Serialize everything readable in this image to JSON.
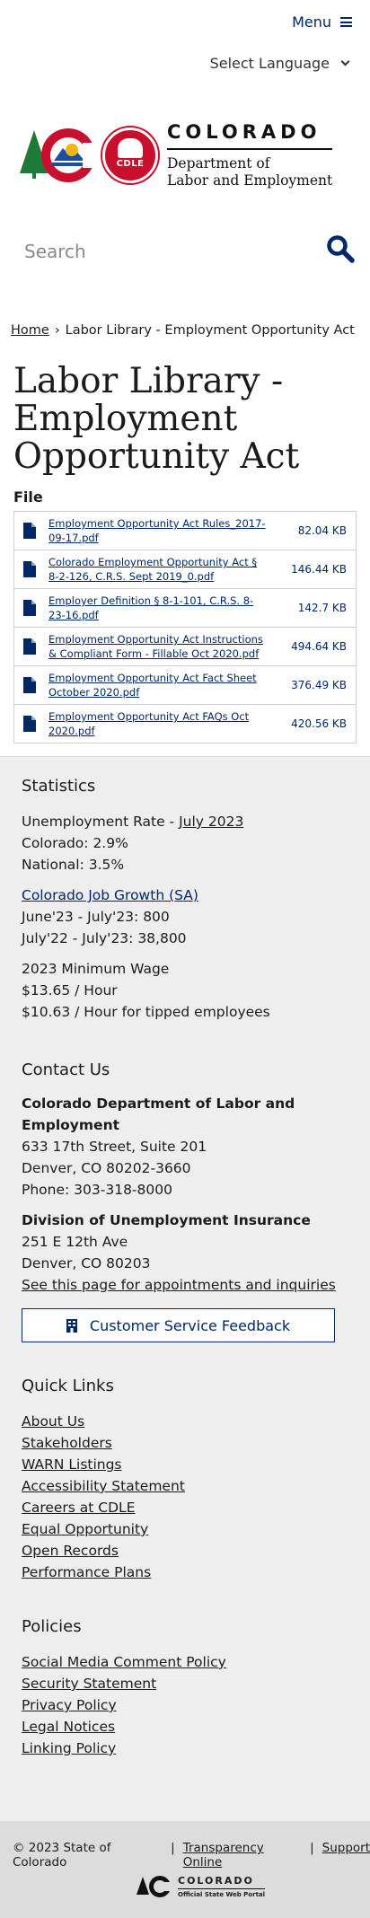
{
  "header": {
    "menu_label": "Menu",
    "language_label": "Select Language",
    "brand": "COLORADO",
    "dept_line1": "Department of",
    "dept_line2": "Labor and Employment",
    "seal_label": "CDLE",
    "search_placeholder": "Search"
  },
  "breadcrumb": {
    "home": "Home",
    "separator": "›",
    "current": "Labor Library - Employment Opportunity Act"
  },
  "page": {
    "title": "Labor Library - Employment Opportunity Act",
    "file_label": "File",
    "files": [
      {
        "name": "Employment Opportunity Act Rules_2017-09-17.pdf",
        "size": "82.04 KB"
      },
      {
        "name": "Colorado Employment Opportunity Act § 8-2-126, C.R.S. Sept 2019_0.pdf",
        "size": "146.44 KB"
      },
      {
        "name": "Employer Definition § 8-1-101, C.R.S. 8-23-16.pdf",
        "size": "142.7 KB"
      },
      {
        "name": "Employment Opportunity Act Instructions & Compliant Form - Fillable Oct 2020.pdf",
        "size": "494.64 KB"
      },
      {
        "name": "Employment Opportunity Act Fact Sheet October 2020.pdf",
        "size": "376.49 KB"
      },
      {
        "name": "Employment Opportunity Act FAQs Oct 2020.pdf",
        "size": "420.56 KB"
      }
    ]
  },
  "statistics": {
    "heading": "Statistics",
    "unemployment_prefix": "Unemployment Rate - ",
    "unemployment_link": "July 2023",
    "colorado": "Colorado: 2.9%",
    "national": "National: 3.5%",
    "job_growth_link": "Colorado Job Growth (SA)",
    "job_growth_1": "June'23 - July'23: 800",
    "job_growth_2": "July'22 - July'23: 38,800",
    "min_wage_title": "2023 Minimum Wage",
    "min_wage_1": "$13.65 / Hour",
    "min_wage_2": "$10.63 / Hour for tipped employees"
  },
  "contact": {
    "heading": "Contact Us",
    "org_line1": "Colorado Department of Labor and",
    "org_line2": "Employment",
    "address1": "633 17th Street, Suite 201",
    "address2": "Denver, CO  80202-3660",
    "phone": "Phone: 303-318-8000",
    "div_name": "Division of Unemployment Insurance",
    "div_address1": "251 E 12th Ave",
    "div_address2": "Denver, CO  80203",
    "div_link": "See this page for appointments and inquiries",
    "feedback_button": "Customer Service Feedback"
  },
  "quick_links": {
    "heading": "Quick Links",
    "items": [
      "About Us",
      "Stakeholders",
      "WARN Listings",
      "Accessibility Statement",
      "Careers at CDLE",
      "Equal Opportunity",
      "Open Records",
      "Performance Plans"
    ]
  },
  "policies": {
    "heading": "Policies",
    "items": [
      "Social Media Comment Policy",
      "Security Statement",
      "Privacy Policy",
      "Legal Notices",
      "Linking Policy"
    ]
  },
  "bottom": {
    "copyright": "© 2023 State of Colorado",
    "sep": "|",
    "transparency": "Transparency Online",
    "support": "Support",
    "portal_brand": "COLORADO",
    "portal_sub": "Official State Web Portal"
  },
  "colors": {
    "link_blue": "#002868",
    "colorado_red": "#c8102e",
    "colorado_green": "#1f7a3a",
    "colorado_gold": "#f2b417",
    "footer_gray": "#eeeeee"
  }
}
